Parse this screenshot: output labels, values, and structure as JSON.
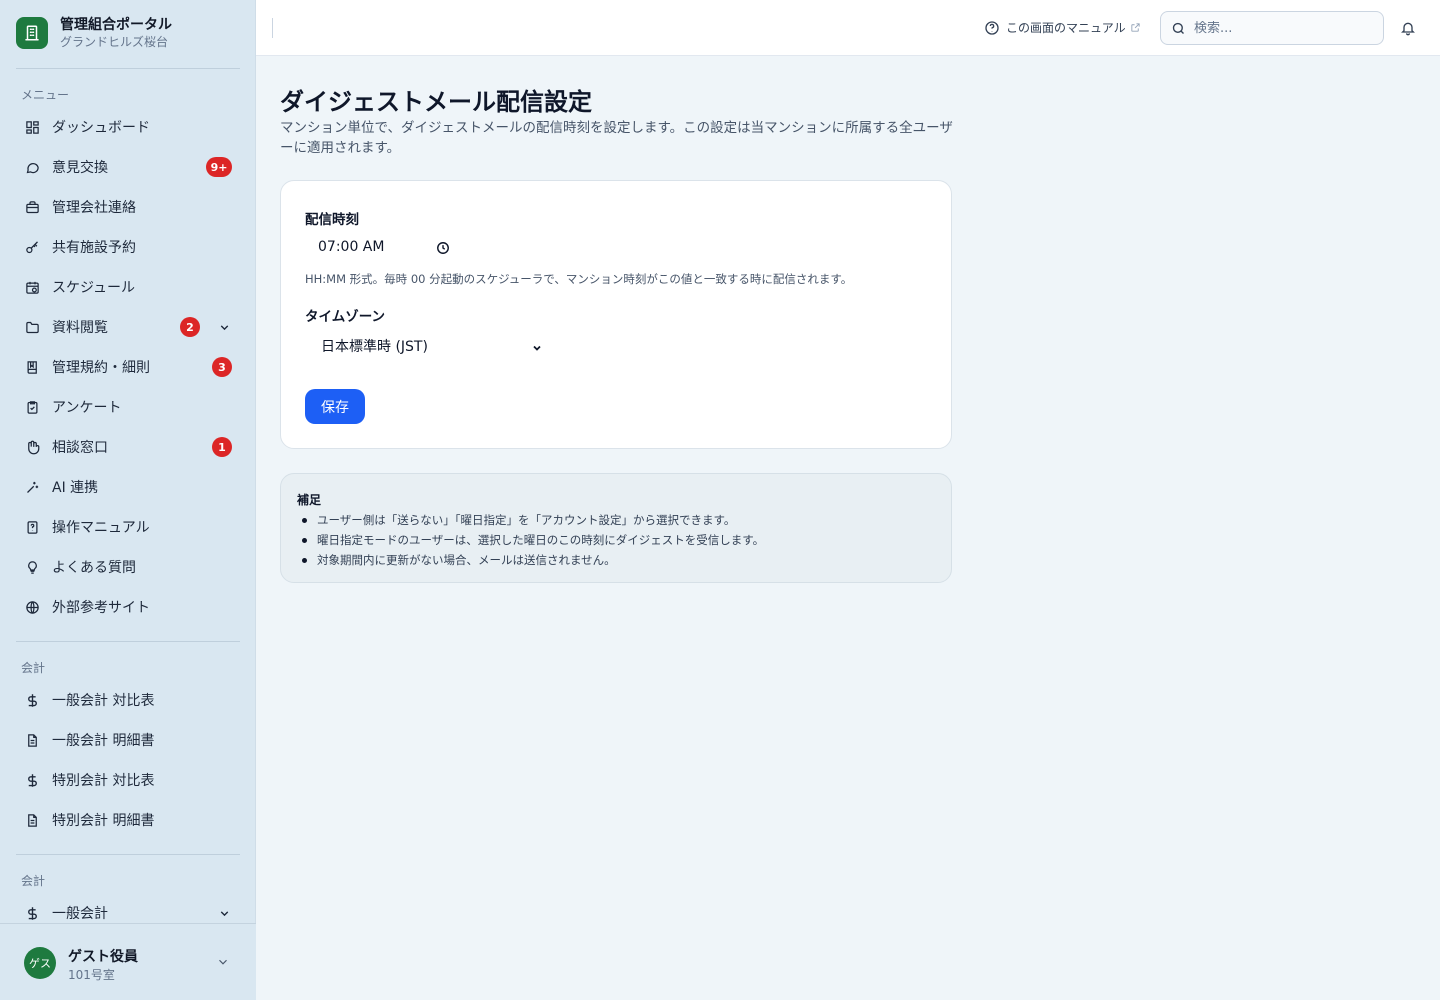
{
  "brand": {
    "title": "管理組合ポータル",
    "subtitle": "グランドヒルズ桜台"
  },
  "sidebar": {
    "menu_label": "メニュー",
    "items": [
      {
        "label": "ダッシュボード",
        "icon": "dashboard-icon"
      },
      {
        "label": "意見交換",
        "icon": "chat-icon",
        "badge": "9+"
      },
      {
        "label": "管理会社連絡",
        "icon": "briefcase-icon"
      },
      {
        "label": "共有施設予約",
        "icon": "key-icon"
      },
      {
        "label": "スケジュール",
        "icon": "calendar-clock-icon"
      },
      {
        "label": "資料閲覧",
        "icon": "folder-icon",
        "badge": "2"
      },
      {
        "label": "管理規約・細則",
        "icon": "book-icon",
        "badge": "3"
      },
      {
        "label": "アンケート",
        "icon": "clipboard-icon"
      },
      {
        "label": "相談窓口",
        "icon": "hand-icon",
        "badge": "1"
      },
      {
        "label": "AI 連携",
        "icon": "sparkle-icon"
      },
      {
        "label": "操作マニュアル",
        "icon": "manual-icon"
      },
      {
        "label": "よくある質問",
        "icon": "lightbulb-icon"
      },
      {
        "label": "外部参考サイト",
        "icon": "globe-icon"
      }
    ],
    "accounting_label": "会計",
    "accounting_items": [
      {
        "label": "一般会計 対比表",
        "icon": "dollar-icon"
      },
      {
        "label": "一般会計 明細書",
        "icon": "document-icon"
      },
      {
        "label": "特別会計 対比表",
        "icon": "dollar-icon"
      },
      {
        "label": "特別会計 明細書",
        "icon": "document-icon"
      }
    ],
    "accounting2_label": "会計",
    "accounting2_items": [
      {
        "label": "一般会計",
        "icon": "dollar-icon"
      }
    ]
  },
  "user": {
    "avatar": "ゲス",
    "name": "ゲスト役員",
    "room": "101号室"
  },
  "header": {
    "manual_link": "この画面のマニュアル",
    "search_placeholder": "検索..."
  },
  "main": {
    "title": "ダイジェストメール配信設定",
    "description": "マンション単位で、ダイジェストメールの配信時刻を設定します。この設定は当マンションに所属する全ユーザーに適用されます。",
    "time_label": "配信時刻",
    "time_value": "07:00 AM",
    "time_hint": "HH:MM 形式。毎時 00 分起動のスケジューラで、マンション時刻がこの値と一致する時に配信されます。",
    "timezone_label": "タイムゾーン",
    "timezone_value": "日本標準時 (JST)",
    "save_label": "保存"
  },
  "note": {
    "title": "補足",
    "items": [
      "ユーザー側は「送らない」「曜日指定」を「アカウント設定」から選択できます。",
      "曜日指定モードのユーザーは、選択した曜日のこの時刻にダイジェストを受信します。",
      "対象期間内に更新がない場合、メールは送信されません。"
    ]
  },
  "colors": {
    "brand": "#1e7a3f",
    "primary": "#1d5ff5",
    "badge": "#dc2626"
  }
}
